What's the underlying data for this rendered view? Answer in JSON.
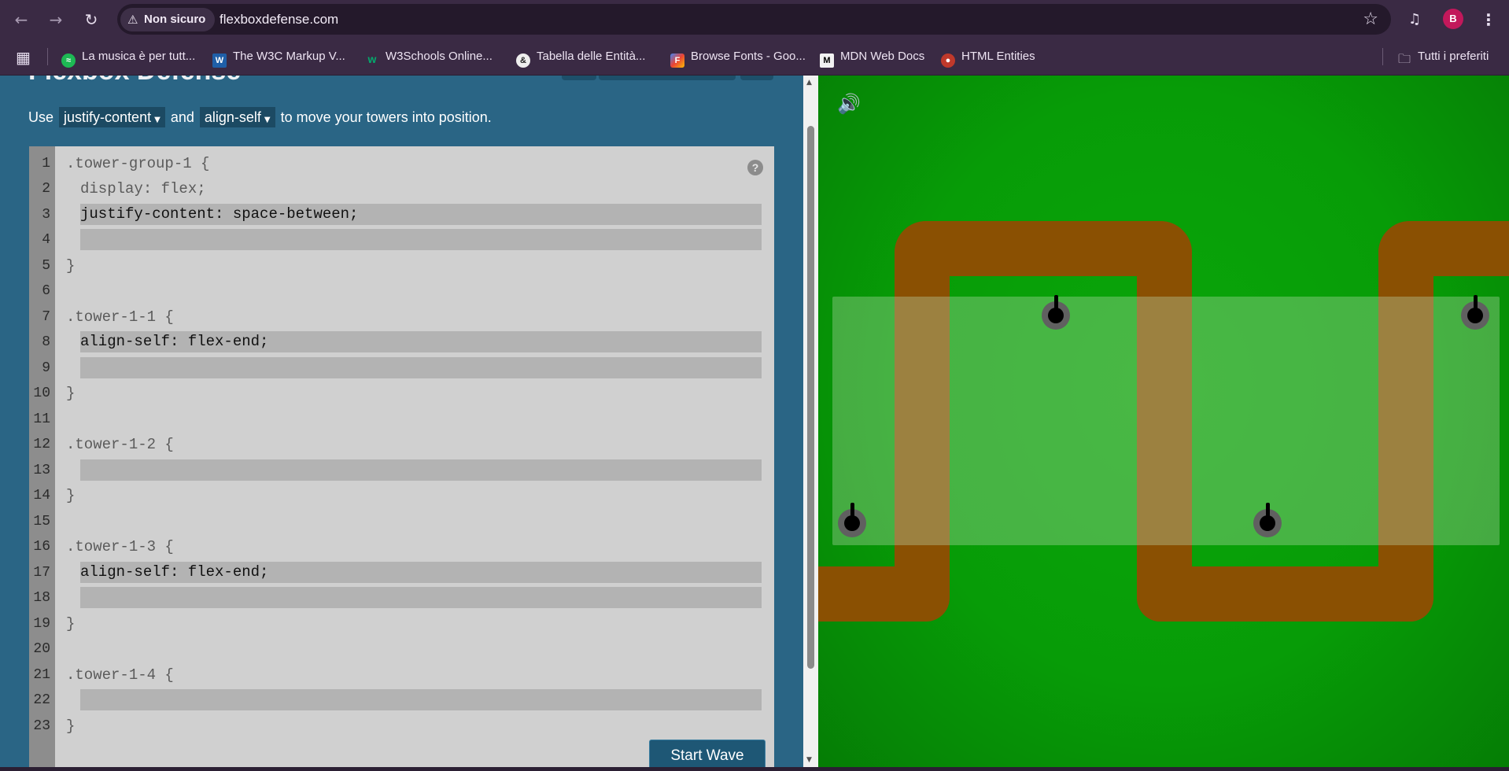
{
  "browser": {
    "security_label": "Non sicuro",
    "url": "flexboxdefense.com",
    "profile_initial": "B",
    "back_icon": "arrow-left-icon",
    "forward_icon": "arrow-right-icon",
    "reload_icon": "reload-icon"
  },
  "bookmarks": {
    "items": [
      {
        "label": "La musica è per tutt...",
        "icon": "spotify-icon",
        "color": "#1db954"
      },
      {
        "label": "The W3C Markup V...",
        "icon": "w3c-icon",
        "color": "#1f5fa8"
      },
      {
        "label": "W3Schools Online...",
        "icon": "w3schools-icon",
        "color": "#04aa6d"
      },
      {
        "label": "Tabella delle Entità...",
        "icon": "entity-icon",
        "color": "#222222"
      },
      {
        "label": "Browse Fonts - Goo...",
        "icon": "google-fonts-icon",
        "color": "#ea4335"
      },
      {
        "label": "MDN Web Docs",
        "icon": "mdn-icon",
        "color": "#111111"
      },
      {
        "label": "HTML Entities",
        "icon": "html-entities-icon",
        "color": "#c0392b"
      }
    ],
    "all_favorites": "Tutti i preferiti"
  },
  "page": {
    "title": "Flexbox Defense",
    "instructions": {
      "prefix": "Use",
      "dropdown1": "justify-content",
      "middle": "and",
      "dropdown2": "align-self",
      "suffix": "to move your towers into position."
    },
    "editor": {
      "line_numbers": [
        "1",
        "2",
        "3",
        "4",
        "5",
        "6",
        "7",
        "8",
        "9",
        "10",
        "11",
        "12",
        "13",
        "14",
        "15",
        "16",
        "17",
        "18",
        "19",
        "20",
        "21",
        "22",
        "23"
      ],
      "l1": ".tower-group-1 {",
      "l2": "display: flex;",
      "l3": "justify-content: space-between;",
      "l4": "",
      "l5": "}",
      "l7": ".tower-1-1 {",
      "l8": "align-self: flex-end;",
      "l9": "",
      "l10": "}",
      "l12": ".tower-1-2 {",
      "l13": "",
      "l14": "}",
      "l16": ".tower-1-3 {",
      "l17": "align-self: flex-end;",
      "l18": "",
      "l19": "}",
      "l21": ".tower-1-4 {",
      "l22": "",
      "l23": "}",
      "help": "?"
    },
    "start_wave": "Start Wave"
  },
  "board": {
    "colors": {
      "grass": "#079c07",
      "path": "#8a5002"
    }
  }
}
